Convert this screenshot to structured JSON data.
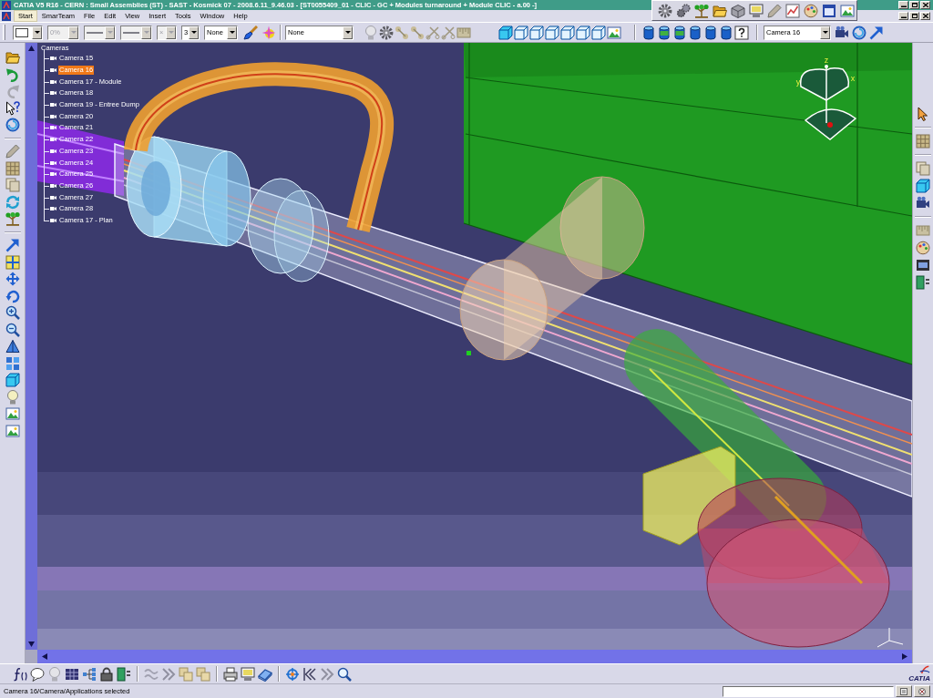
{
  "title_bar": {
    "title": "CATIA V5 R16 - CERN : Small Assemblies (ST) - SAST - Kosmick 07 - 2008.6.11_9.46.03 - [ST0055409_01 - CLIC - GC + Modules turnaround + Module CLIC - a.00 -]"
  },
  "menu_bar": {
    "items": [
      {
        "label": "Start",
        "selected": true
      },
      {
        "label": "SmarTeam",
        "selected": false
      },
      {
        "label": "File",
        "selected": false
      },
      {
        "label": "Edit",
        "selected": false
      },
      {
        "label": "View",
        "selected": false
      },
      {
        "label": "Insert",
        "selected": false
      },
      {
        "label": "Tools",
        "selected": false
      },
      {
        "label": "Window",
        "selected": false
      },
      {
        "label": "Help",
        "selected": false
      }
    ]
  },
  "graphic_properties": {
    "combos": [
      {
        "kind": "color",
        "disabled": false
      },
      {
        "kind": "text",
        "value": "0%",
        "disabled": true
      },
      {
        "kind": "line",
        "disabled": true
      },
      {
        "kind": "line",
        "disabled": true
      },
      {
        "kind": "text",
        "value": "×",
        "disabled": true
      },
      {
        "kind": "text",
        "value": "3",
        "disabled": false
      },
      {
        "kind": "text",
        "value": "None",
        "disabled": false
      }
    ]
  },
  "layer_combo": {
    "value": "None"
  },
  "camera_combo": {
    "value": "Camera 16"
  },
  "tree": {
    "label": "Cameras",
    "children": [
      {
        "label": "Camera 15",
        "selected": false
      },
      {
        "label": "Camera 16",
        "selected": true
      },
      {
        "label": "Camera 17 - Module",
        "selected": false
      },
      {
        "label": "Camera 18",
        "selected": false
      },
      {
        "label": "Camera 19 - Entree Dump",
        "selected": false
      },
      {
        "label": "Camera 20",
        "selected": false
      },
      {
        "label": "Camera 21",
        "selected": false
      },
      {
        "label": "Camera 22",
        "selected": false
      },
      {
        "label": "Camera 23",
        "selected": false
      },
      {
        "label": "Camera 24",
        "selected": false
      },
      {
        "label": "Camera 25",
        "selected": false
      },
      {
        "label": "Camera 26",
        "selected": false
      },
      {
        "label": "Camera 27",
        "selected": false
      },
      {
        "label": "Camera 28",
        "selected": false
      },
      {
        "label": "Camera 17 - Plan",
        "selected": false
      }
    ]
  },
  "compass": {
    "axes": [
      "z",
      "y",
      "x"
    ]
  },
  "logo": {
    "text": "CATIA"
  },
  "status_bar": {
    "message": "Camera 16/Camera/Applications selected"
  }
}
